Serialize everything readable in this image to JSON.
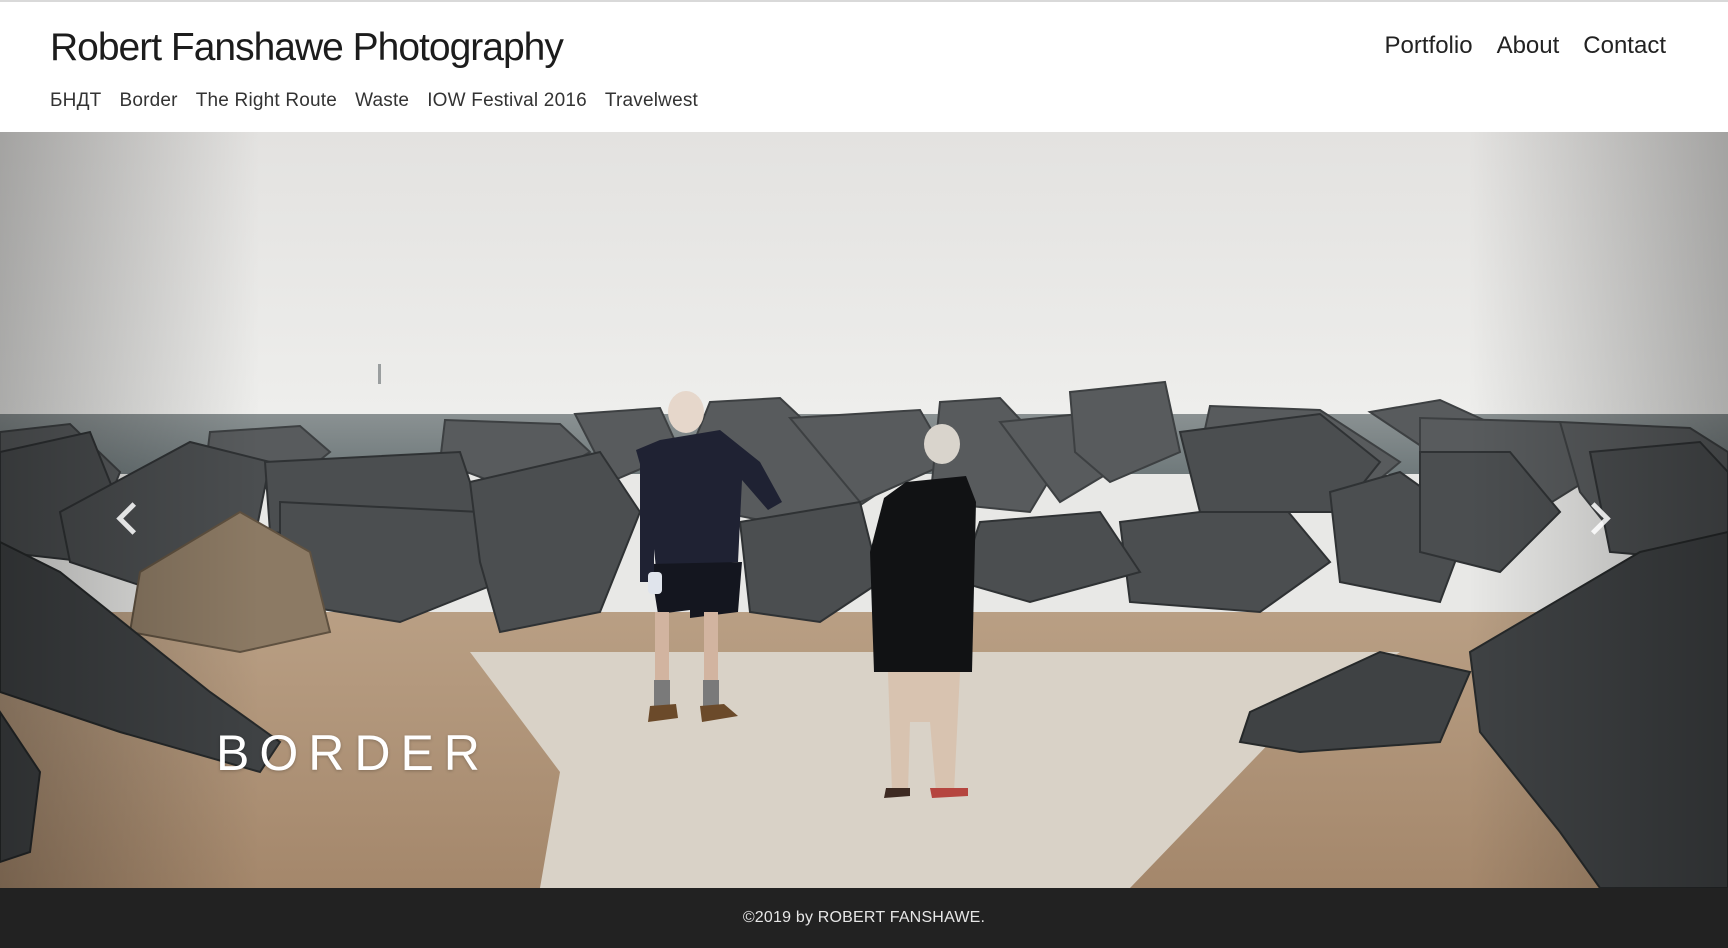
{
  "site": {
    "title": "Robert Fanshawe Photography"
  },
  "main_nav": [
    {
      "label": "Portfolio"
    },
    {
      "label": "About"
    },
    {
      "label": "Contact"
    }
  ],
  "sub_nav": [
    {
      "label": "БНДТ"
    },
    {
      "label": "Border"
    },
    {
      "label": "The Right Route"
    },
    {
      "label": "Waste"
    },
    {
      "label": "IOW Festival 2016"
    },
    {
      "label": "Travelwest"
    }
  ],
  "slideshow": {
    "current_title": "BORDER",
    "prev_icon": "chevron-left-icon",
    "next_icon": "chevron-right-icon"
  },
  "footer": {
    "copyright": "©2019 by ROBERT FANSHAWE."
  },
  "colors": {
    "footer_bg": "#222222",
    "sky": "#e9e8e6",
    "sea": "#7d8687"
  }
}
